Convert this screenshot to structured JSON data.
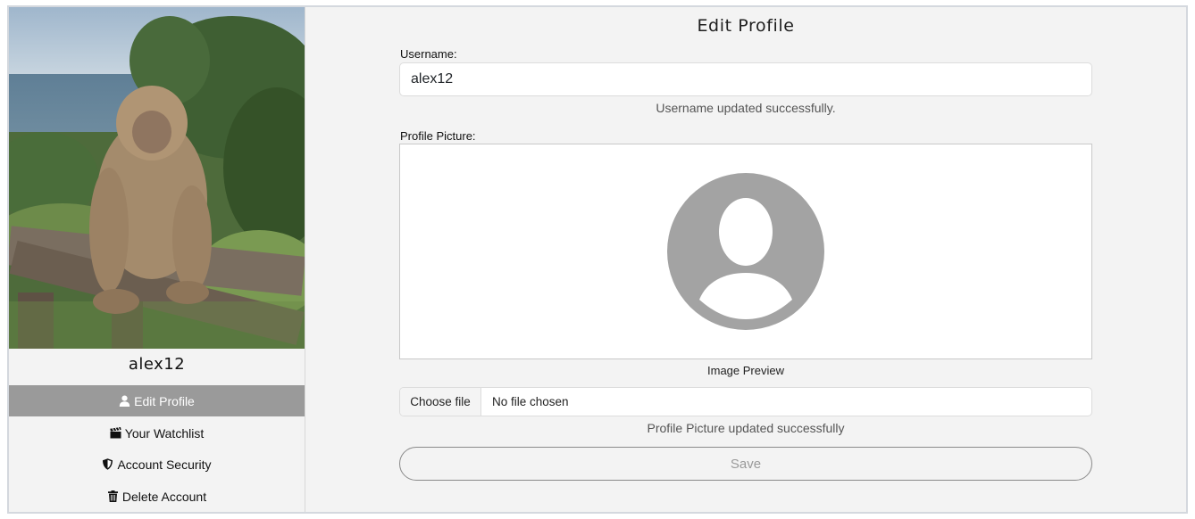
{
  "sidebar": {
    "username": "alex12",
    "items": [
      {
        "label": "Edit Profile",
        "icon": "user-icon",
        "active": true
      },
      {
        "label": "Your Watchlist",
        "icon": "clapperboard-icon",
        "active": false
      },
      {
        "label": "Account Security",
        "icon": "shield-icon",
        "active": false
      },
      {
        "label": "Delete Account",
        "icon": "trash-icon",
        "active": false
      }
    ]
  },
  "main": {
    "title": "Edit Profile",
    "username_label": "Username:",
    "username_value": "alex12",
    "username_message": "Username updated successfully.",
    "picture_label": "Profile Picture:",
    "preview_caption": "Image Preview",
    "file_button": "Choose file",
    "file_status": "No file chosen",
    "picture_message": "Profile Picture updated successfully",
    "save_label": "Save"
  },
  "colors": {
    "active_nav_bg": "#9a9a9a",
    "background": "#f3f3f3",
    "avatar_placeholder": "#a3a3a3"
  }
}
